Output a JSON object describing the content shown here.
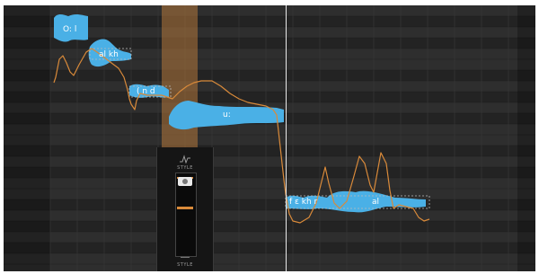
{
  "editor": {
    "notes": [
      {
        "id": "n1",
        "label": "O:  l"
      },
      {
        "id": "n2",
        "label": "al   kh"
      },
      {
        "id": "n3",
        "label": "(   n  d"
      },
      {
        "id": "n4",
        "label": "u:"
      },
      {
        "id": "n5",
        "label": "f  ε  kh r"
      },
      {
        "id": "n6",
        "label": "al"
      }
    ],
    "colors": {
      "background": "#2a2a2a",
      "blob": "#4ab0e6",
      "pitch_curve": "#d98a3a",
      "selection": "#b5783c",
      "playhead": "#e9e9e9"
    }
  },
  "style_panel": {
    "title_top": "STYLE",
    "title_bottom": "STYLE",
    "top_icon": "style-wave-icon"
  }
}
